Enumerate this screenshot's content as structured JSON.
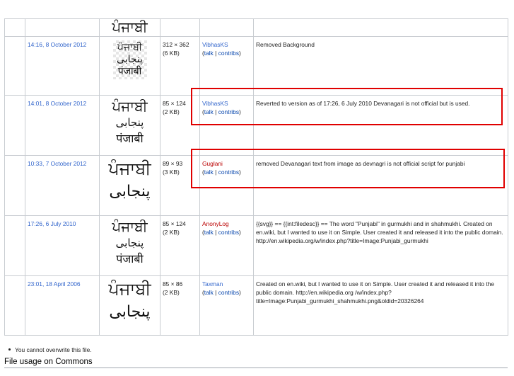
{
  "rows": [
    {
      "date": "",
      "thumb_lines": [
        "ਪੰਜਾਬੀ"
      ],
      "dims": "",
      "size": "",
      "user": "",
      "comment": ""
    },
    {
      "date": "14:16, 8 October 2012",
      "thumb_lines": [
        "ਪੰਜਾਬੀ",
        "پنجابی",
        "पंजाबी"
      ],
      "dims": "312 × 362",
      "size": "(6 KB)",
      "user": "VibhasKS",
      "comment": "Removed Background"
    },
    {
      "date": "14:01, 8 October 2012",
      "thumb_lines": [
        "ਪੰਜਾਬੀ",
        "پنجابی",
        "पंजाबी"
      ],
      "dims": "85 × 124",
      "size": "(2 KB)",
      "user": "VibhasKS",
      "comment": "Reverted to version as of 17:26, 6 July 2010 Devanagari is not official but is used."
    },
    {
      "date": "10:33, 7 October 2012",
      "thumb_lines": [
        "ਪੰਜਾਬੀ",
        "پنجابی"
      ],
      "dims": "89 × 93",
      "size": "(3 KB)",
      "user": "Guglani",
      "comment": "removed Devanagari text from image as devnagri is not official script for punjabi"
    },
    {
      "date": "17:26, 6 July 2010",
      "thumb_lines": [
        "ਪੰਜਾਬੀ",
        "پنجابی",
        "पंजाबी"
      ],
      "dims": "85 × 124",
      "size": "(2 KB)",
      "user": "AnonyLog",
      "comment": "{{svg}} == {{int:filedesc}} == The word \"Punjabi\" in gurmukhi and in shahmukhi. Created on en.wiki, but I wanted to use it on Simple. User created it and released it into the public domain. http://en.wikipedia.org/w/index.php?title=Image:Punjabi_gurmukhi"
    },
    {
      "date": "23:01, 18 April 2006",
      "thumb_lines": [
        "ਪੰਜਾਬੀ",
        "پنجابی"
      ],
      "dims": "85 × 86",
      "size": "(2 KB)",
      "user": "Taxman",
      "comment": "Created on en.wiki, but I wanted to use it on Simple. User created it and released it into the public domain. http://en.wikipedia.org /w/index.php?title=Image:Punjabi_gurmukhi_shahmukhi.png&oldid=20326264"
    }
  ],
  "talk": {
    "open": "(",
    "talk": "talk",
    "sep": " | ",
    "contribs": "contribs",
    "close": ")"
  },
  "note": "You cannot overwrite this file.",
  "section_heading": "File usage on Commons",
  "colors": {
    "highlight": "#e00000",
    "link": "#3366cc",
    "redlink": "#ba0000",
    "border": "#c8ccd1"
  }
}
